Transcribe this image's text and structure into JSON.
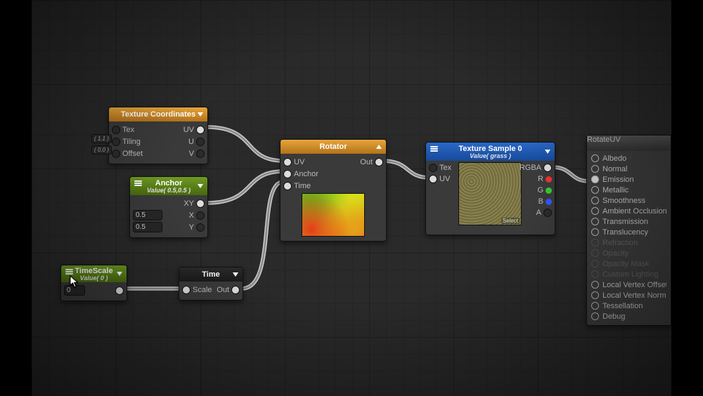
{
  "nodes": {
    "texcoord": {
      "title": "Texture Coordinates",
      "inputs": [
        "Tex",
        "Tiling",
        "Offset"
      ],
      "outputs": [
        "UV",
        "U",
        "V"
      ],
      "side_tags": [
        "( 1,1 )",
        "( 0,0 )"
      ]
    },
    "anchor": {
      "title": "Anchor",
      "subtitle": "Value( 0.5,0.5 )",
      "outputs": [
        "XY",
        "X",
        "Y"
      ],
      "field_x": "0.5",
      "field_y": "0.5"
    },
    "timescale": {
      "title": "TimeScale",
      "subtitle": "Value( 0 )",
      "field": "0"
    },
    "time": {
      "title": "Time",
      "inputs": [
        "Scale"
      ],
      "outputs": [
        "Out"
      ]
    },
    "rotator": {
      "title": "Rotator",
      "inputs": [
        "UV",
        "Anchor",
        "Time"
      ],
      "outputs": [
        "Out"
      ]
    },
    "texsample": {
      "title": "Texture Sample 0",
      "subtitle": "Value( grass )",
      "inputs": [
        "Tex",
        "UV"
      ],
      "outputs": [
        "RGBA",
        "R",
        "G",
        "B",
        "A"
      ],
      "preview_label": "Select"
    }
  },
  "result": {
    "title": "RotateUV",
    "items": [
      {
        "label": "Albedo",
        "dis": false
      },
      {
        "label": "Normal",
        "dis": false
      },
      {
        "label": "Emission",
        "dis": false,
        "on": true
      },
      {
        "label": "Metallic",
        "dis": false
      },
      {
        "label": "Smoothness",
        "dis": false
      },
      {
        "label": "Ambient Occlusion",
        "dis": false
      },
      {
        "label": "Transmission",
        "dis": false
      },
      {
        "label": "Translucency",
        "dis": false
      },
      {
        "label": "Refraction",
        "dis": true
      },
      {
        "label": "Opacity",
        "dis": true
      },
      {
        "label": "Opacity Mask",
        "dis": true
      },
      {
        "label": "Custom Lighting",
        "dis": true
      },
      {
        "label": "Local Vertex Offset",
        "dis": false
      },
      {
        "label": "Local Vertex Normal",
        "dis": false
      },
      {
        "label": "Tessellation",
        "dis": false
      },
      {
        "label": "Debug",
        "dis": false
      }
    ]
  }
}
